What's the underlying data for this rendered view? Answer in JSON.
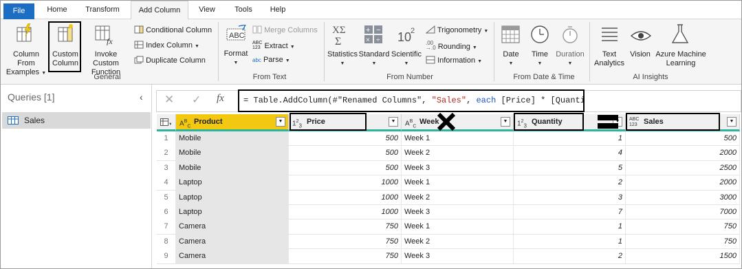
{
  "menu": {
    "file": "File",
    "home": "Home",
    "transform": "Transform",
    "add_column": "Add Column",
    "view": "View",
    "tools": "Tools",
    "help": "Help"
  },
  "ribbon": {
    "general": {
      "label": "General",
      "col_from_examples": "Column From",
      "col_from_examples2": "Examples",
      "custom_column": "Custom",
      "custom_column2": "Column",
      "invoke_custom": "Invoke Custom",
      "invoke_custom2": "Function",
      "conditional": "Conditional Column",
      "index": "Index Column",
      "duplicate": "Duplicate Column"
    },
    "from_text": {
      "label": "From Text",
      "format": "Format",
      "merge": "Merge Columns",
      "extract": "Extract",
      "parse": "Parse"
    },
    "from_number": {
      "label": "From Number",
      "statistics": "Statistics",
      "standard": "Standard",
      "scientific": "Scientific",
      "trig": "Trigonometry",
      "rounding": "Rounding",
      "information": "Information"
    },
    "from_datetime": {
      "label": "From Date & Time",
      "date": "Date",
      "time": "Time",
      "duration": "Duration"
    },
    "ai": {
      "label": "AI Insights",
      "text": "Text",
      "text2": "Analytics",
      "vision": "Vision",
      "azure": "Azure Machine",
      "azure2": "Learning"
    }
  },
  "queries": {
    "title": "Queries [1]",
    "item": "Sales"
  },
  "formula": {
    "prefix": "= Table.AddColumn(#\"Renamed Columns\", ",
    "str": "\"Sales\"",
    "mid": ", ",
    "kw": "each",
    "rest": " [Price] * [Quantity])"
  },
  "formula_icons": {
    "fx": "fx"
  },
  "columns": [
    {
      "type": "ABC",
      "name": "Product"
    },
    {
      "type": "123",
      "name": "Price"
    },
    {
      "type": "ABC",
      "name": "Week"
    },
    {
      "type": "123",
      "name": "Quantity"
    },
    {
      "type": "ABC123",
      "name": "Sales"
    }
  ],
  "rows": [
    {
      "i": "1",
      "product": "Mobile",
      "price": "500",
      "week": "Week 1",
      "qty": "1",
      "sales": "500"
    },
    {
      "i": "2",
      "product": "Mobile",
      "price": "500",
      "week": "Week 2",
      "qty": "4",
      "sales": "2000"
    },
    {
      "i": "3",
      "product": "Mobile",
      "price": "500",
      "week": "Week 3",
      "qty": "5",
      "sales": "2500"
    },
    {
      "i": "4",
      "product": "Laptop",
      "price": "1000",
      "week": "Week 1",
      "qty": "2",
      "sales": "2000"
    },
    {
      "i": "5",
      "product": "Laptop",
      "price": "1000",
      "week": "Week 2",
      "qty": "3",
      "sales": "3000"
    },
    {
      "i": "6",
      "product": "Laptop",
      "price": "1000",
      "week": "Week 3",
      "qty": "7",
      "sales": "7000"
    },
    {
      "i": "7",
      "product": "Camera",
      "price": "750",
      "week": "Week 1",
      "qty": "1",
      "sales": "750"
    },
    {
      "i": "8",
      "product": "Camera",
      "price": "750",
      "week": "Week 2",
      "qty": "1",
      "sales": "750"
    },
    {
      "i": "9",
      "product": "Camera",
      "price": "750",
      "week": "Week 3",
      "qty": "2",
      "sales": "1500"
    }
  ],
  "colors": {
    "accent": "#1b6ec2",
    "selected_header": "#f2c811",
    "quality_bar": "#2db39c"
  }
}
